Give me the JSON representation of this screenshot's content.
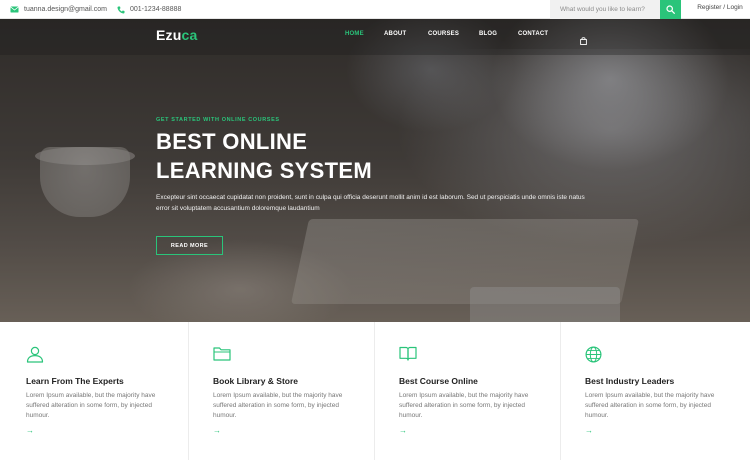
{
  "topbar": {
    "email": "tuanna.design@gmail.com",
    "phone": "001-1234-88888",
    "search_placeholder": "What would you like to learn?",
    "login": "Register / Login"
  },
  "nav": {
    "logo_main": "Ezu",
    "logo_accent": "ca",
    "links": [
      "HOME",
      "ABOUT",
      "COURSES",
      "BLOG",
      "CONTACT"
    ]
  },
  "hero": {
    "eyebrow": "GET STARTED WITH ONLINE COURSES",
    "headline_line1": "BEST ONLINE",
    "headline_line2": "LEARNING SYSTEM",
    "description": "Excepteur sint occaecat cupidatat non proident, sunt in culpa qui officia deserunt mollit anim id est laborum. Sed ut perspiciatis unde omnis iste natus error sit voluptatem accusantium doloremque laudantium",
    "button": "READ MORE"
  },
  "features": [
    {
      "icon": "user-icon",
      "title": "Learn From The Experts",
      "text": "Lorem Ipsum available, but the majority have suffered alteration in some form, by injected humour.",
      "arrow": "→"
    },
    {
      "icon": "folder-icon",
      "title": "Book Library & Store",
      "text": "Lorem Ipsum available, but the majority have suffered alteration in some form, by injected humour.",
      "arrow": "→"
    },
    {
      "icon": "book-icon",
      "title": "Best Course Online",
      "text": "Lorem Ipsum available, but the majority have suffered alteration in some form, by injected humour.",
      "arrow": "→"
    },
    {
      "icon": "globe-icon",
      "title": "Best Industry Leaders",
      "text": "Lorem Ipsum available, but the majority have suffered alteration in some form, by injected humour.",
      "arrow": "→"
    }
  ],
  "colors": {
    "accent": "#2ac47a"
  }
}
